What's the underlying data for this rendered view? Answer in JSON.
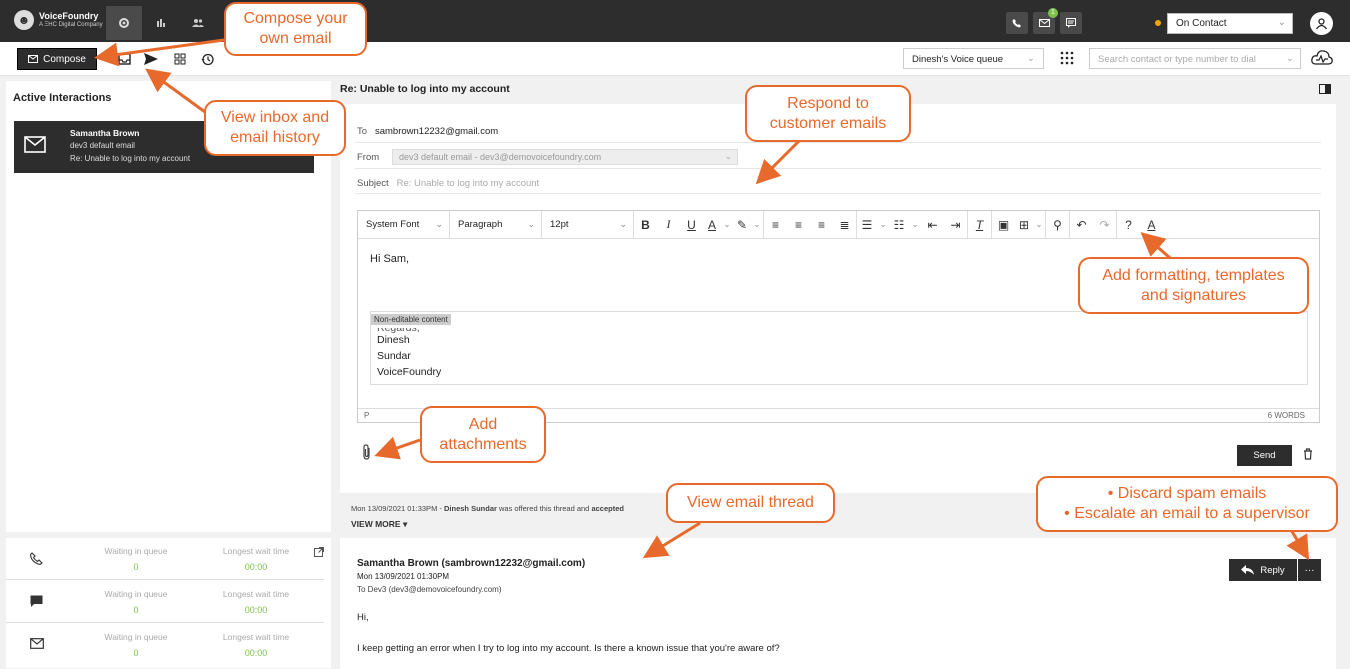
{
  "topbar": {
    "logo_name": "VoiceFoundry",
    "logo_sub": "A ΞHC Digital Company",
    "mail_badge": "1",
    "status_value": "On Contact"
  },
  "subbar": {
    "compose_label": "Compose",
    "queue_select": "Dinesh's Voice queue",
    "dial_placeholder": "Search contact or type number to dial"
  },
  "left_panel": {
    "title": "Active Interactions",
    "card": {
      "name": "Samantha Brown",
      "line2": "dev3 default email",
      "line3": "Re: Unable to log into my account"
    }
  },
  "stats": {
    "rows": [
      {
        "icon": "phone-icon",
        "waiting_label": "Waiting in queue",
        "waiting_value": "0",
        "longest_label": "Longest wait time",
        "longest_value": "00:00"
      },
      {
        "icon": "chat-icon",
        "waiting_label": "Waiting in queue",
        "waiting_value": "0",
        "longest_label": "Longest wait time",
        "longest_value": "00:00"
      },
      {
        "icon": "mail-icon",
        "waiting_label": "Waiting in queue",
        "waiting_value": "0",
        "longest_label": "Longest wait time",
        "longest_value": "00:00"
      }
    ]
  },
  "email": {
    "subject_heading": "Re: Unable to log into my account",
    "to_label": "To",
    "to_value": "sambrown12232@gmail.com",
    "from_label": "From",
    "from_value": "dev3 default email - dev3@demovoicefoundry.com",
    "subject_label": "Subject",
    "subject_value": "Re: Unable to log into my account",
    "toolbar": {
      "font": "System Font",
      "block": "Paragraph",
      "size": "12pt"
    },
    "body_greeting": "Hi Sam,",
    "sig_tag": "Non-editable content",
    "sig_partial": "Regards,",
    "sig_lines": [
      "Dinesh",
      "Sundar",
      "VoiceFoundry"
    ],
    "status_path": "P",
    "word_count": "6 WORDS",
    "send_label": "Send"
  },
  "thread": {
    "info_date": "Mon 13/09/2021 01:33PM - ",
    "info_agent": "Dinesh Sundar",
    "info_mid": " was offered this thread and ",
    "info_end": "accepted",
    "view_more": "VIEW MORE ▾",
    "from": "Samantha Brown (sambrown12232@gmail.com)",
    "date": "Mon 13/09/2021 01:30PM",
    "to": "To Dev3 (dev3@demovoicefoundry.com)",
    "greeting": "Hi,",
    "message": "I keep getting an error when I try to log into my account. Is there a known issue that you're aware of?",
    "reply_label": "Reply",
    "more_label": "···"
  },
  "callouts": {
    "compose": [
      "Compose your",
      "own email"
    ],
    "inbox": [
      "View inbox and",
      "email history"
    ],
    "respond": [
      "Respond to",
      "customer emails"
    ],
    "formatting": [
      "Add formatting, templates",
      "and signatures"
    ],
    "attachments": [
      "Add",
      "attachments"
    ],
    "thread": [
      "View email thread"
    ],
    "discard": [
      "• Discard spam emails",
      "• Escalate an email to a supervisor"
    ]
  },
  "colors": {
    "dark": "#2d2d2d",
    "accent_orange": "#e8692c",
    "status_green": "#7dc24b",
    "status_amber": "#f3a600"
  }
}
